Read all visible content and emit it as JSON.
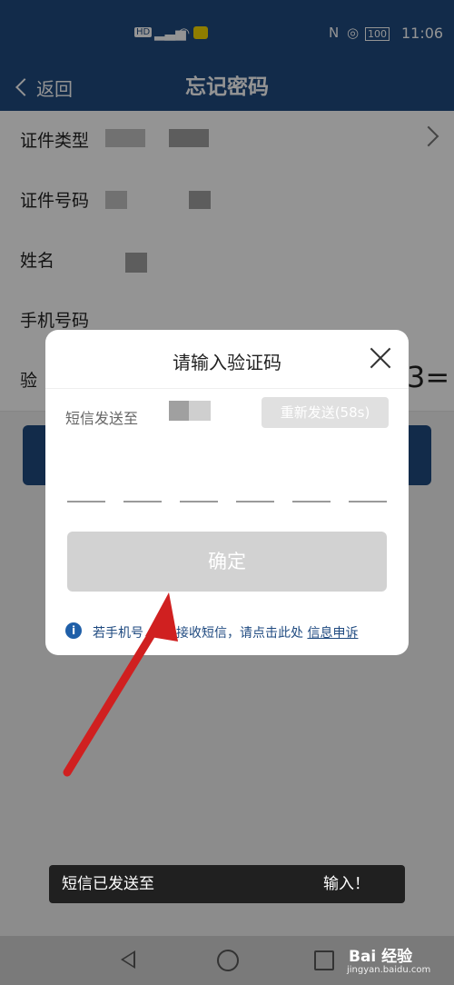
{
  "status_bar": {
    "left_icons": "HD",
    "nfc": "N",
    "battery": "100",
    "time": "11:06"
  },
  "nav": {
    "back_label": "返回",
    "title": "忘记密码"
  },
  "form": {
    "rows": [
      {
        "label": "证件类型"
      },
      {
        "label": "证件号码"
      },
      {
        "label": "姓名"
      },
      {
        "label": "手机号码"
      },
      {
        "label": "验"
      }
    ],
    "captcha_text": "3="
  },
  "dialog": {
    "title": "请输入验证码",
    "sms_label": "短信发送至",
    "resend_label": "重新发送(58s)",
    "confirm_label": "确定",
    "info_prefix": "若手机号",
    "info_middle": "去接收短信，请点击此处",
    "info_link": "信息申诉"
  },
  "toast": {
    "left": "短信已发送至",
    "right": "输入！"
  },
  "watermark": {
    "main": "Bai 经验",
    "sub": "jingyan.baidu.com"
  },
  "colors": {
    "primary": "#1f4a80",
    "confirm_disabled": "#d2d2d2",
    "arrow": "#d02020"
  }
}
